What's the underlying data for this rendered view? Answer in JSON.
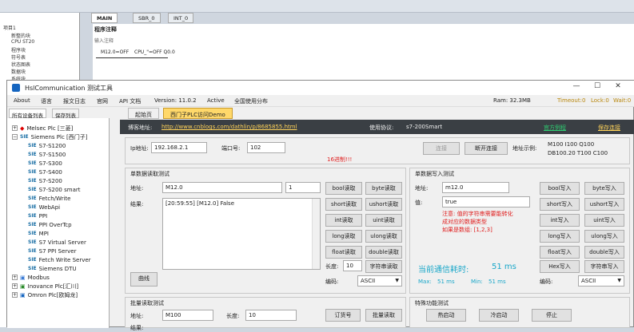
{
  "bg": {
    "tree": [
      "项目1",
      "新整的块",
      "CPU ST20",
      "程序块",
      "符号表",
      "状态图表",
      "数据块",
      "系统块"
    ],
    "tabs": [
      "MAIN",
      "SBR_0",
      "INT_0"
    ],
    "ladder_title": "程序注释",
    "ladder_comment": "输入注释",
    "ladder_in": "M12.0=OFF",
    "ladder_cpu": "CPU_\"=OFF Q0.0"
  },
  "window": {
    "title": "HslCommunication 测试工具",
    "min": "—",
    "max": "☐",
    "close": "✕"
  },
  "menu": {
    "items": [
      "About",
      "语言",
      "报文日志",
      "官网",
      "API 文档",
      "Version: 11.0.2",
      "Active",
      "全国使用分布"
    ],
    "ram": "Ram: 32.3MB",
    "timeout": "Timeout:0",
    "lock": "Lock:0",
    "wait": "Wait:0"
  },
  "left": {
    "tabs": [
      "所有设备列表",
      "保存列表"
    ],
    "nodes": [
      "Melsec Plc [三菱]",
      "Siemens Plc [西门子]",
      "S7-S1200",
      "S7-S1500",
      "S7-S300",
      "S7-S400",
      "S7-S200",
      "S7-S200 smart",
      "Fetch/Write",
      "WebApi",
      "PPI",
      "PPI OverTcp",
      "MPI",
      "S7 Virtual Server",
      "S7 PPI Server",
      "Fetch Write Server",
      "Siemens DTU",
      "Modbus",
      "Inovance Plc[汇川]",
      "Omron Plc[欧姆龙]"
    ],
    "sie": "SIE"
  },
  "main": {
    "tabs": [
      "起始页",
      "西门子PLC访问Demo"
    ],
    "blog_label": "博客地址:",
    "blog_url": "http://www.cnblogs.com/dathlin/p/8685855.html",
    "protocol_label": "使用协议:",
    "protocol": "s7-200Smart",
    "official": "官方例程",
    "save_conn": "保存连接",
    "ip_label": "Ip地址:",
    "ip": "192.168.2.1",
    "port_label": "端口号:",
    "port": "102",
    "connect": "连接",
    "disconnect": "断开连接",
    "warn": "16进制!!!",
    "addr_example_label": "地址示例:",
    "addr_example1": "M100  I100  Q100",
    "addr_example2": "DB100.20  T100  C100",
    "read": {
      "title": "单数据读取测试",
      "addr_label": "地址:",
      "addr": "M12.0",
      "count": "1",
      "result_label": "结果:",
      "result": "[20:59:55] [M12.0] False",
      "btns": [
        "bool读取",
        "byte读取",
        "short读取",
        "ushort读取",
        "int读取",
        "uint读取",
        "long读取",
        "ulong读取",
        "float读取",
        "double读取"
      ],
      "len_label": "长度:",
      "len": "10",
      "str_read": "字符串读取",
      "enc_label": "编码:",
      "enc": "ASCII",
      "curve": "曲线"
    },
    "write": {
      "title": "单数据写入测试",
      "addr_label": "地址:",
      "addr": "m12.0",
      "val_label": "值:",
      "val": "true",
      "note1": "注意: 值的字符串需要能转化",
      "note2": "成对应的数据类型",
      "note3": "如果是数组: [1,2,3]",
      "btns": [
        "bool写入",
        "byte写入",
        "short写入",
        "ushort写入",
        "int写入",
        "uint写入",
        "long写入",
        "ulong写入",
        "float写入",
        "double写入",
        "Hex写入",
        "字符串写入"
      ],
      "time_label": "当前通信耗时:",
      "time": "51 ms",
      "max_label": "Max:",
      "max": "51 ms",
      "min_label": "Min:",
      "min": "51 ms",
      "enc_label": "编码:",
      "enc": "ASCII"
    },
    "batch": {
      "title": "批量读取测试",
      "addr_label": "地址:",
      "addr": "M100",
      "len_label": "长度:",
      "len": "10",
      "order": "订货号",
      "read": "批量读取",
      "result_label": "结果:"
    },
    "special": {
      "title": "特殊功能测试",
      "hot": "热启动",
      "cold": "冷启动",
      "stop": "停止"
    }
  }
}
